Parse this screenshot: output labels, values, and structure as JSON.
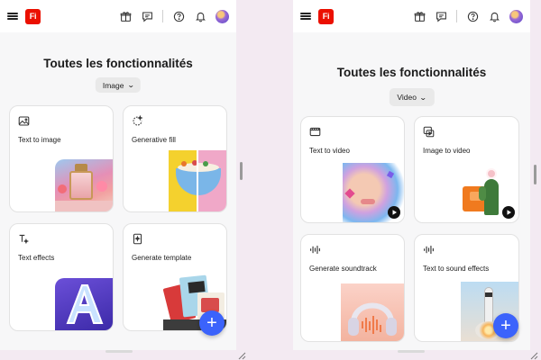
{
  "app": {
    "logo_text": "Fi"
  },
  "left": {
    "title": "Toutes les fonctionnalités",
    "filter_value": "Image",
    "cards": [
      {
        "label": "Text to image",
        "icon": "image-icon"
      },
      {
        "label": "Generative fill",
        "icon": "generative-fill-icon"
      },
      {
        "label": "Text effects",
        "icon": "text-effects-icon"
      },
      {
        "label": "Generate template",
        "icon": "template-icon"
      }
    ]
  },
  "right": {
    "title": "Toutes les fonctionnalités",
    "filter_value": "Video",
    "cards": [
      {
        "label": "Text to video",
        "icon": "video-icon"
      },
      {
        "label": "Image to video",
        "icon": "image-to-video-icon"
      },
      {
        "label": "Generate soundtrack",
        "icon": "audio-wave-icon"
      },
      {
        "label": "Text to sound effects",
        "icon": "audio-wave-icon"
      }
    ]
  },
  "fab_label": "+",
  "colors": {
    "brand": "#eb1000",
    "fab": "#3b63fb"
  }
}
